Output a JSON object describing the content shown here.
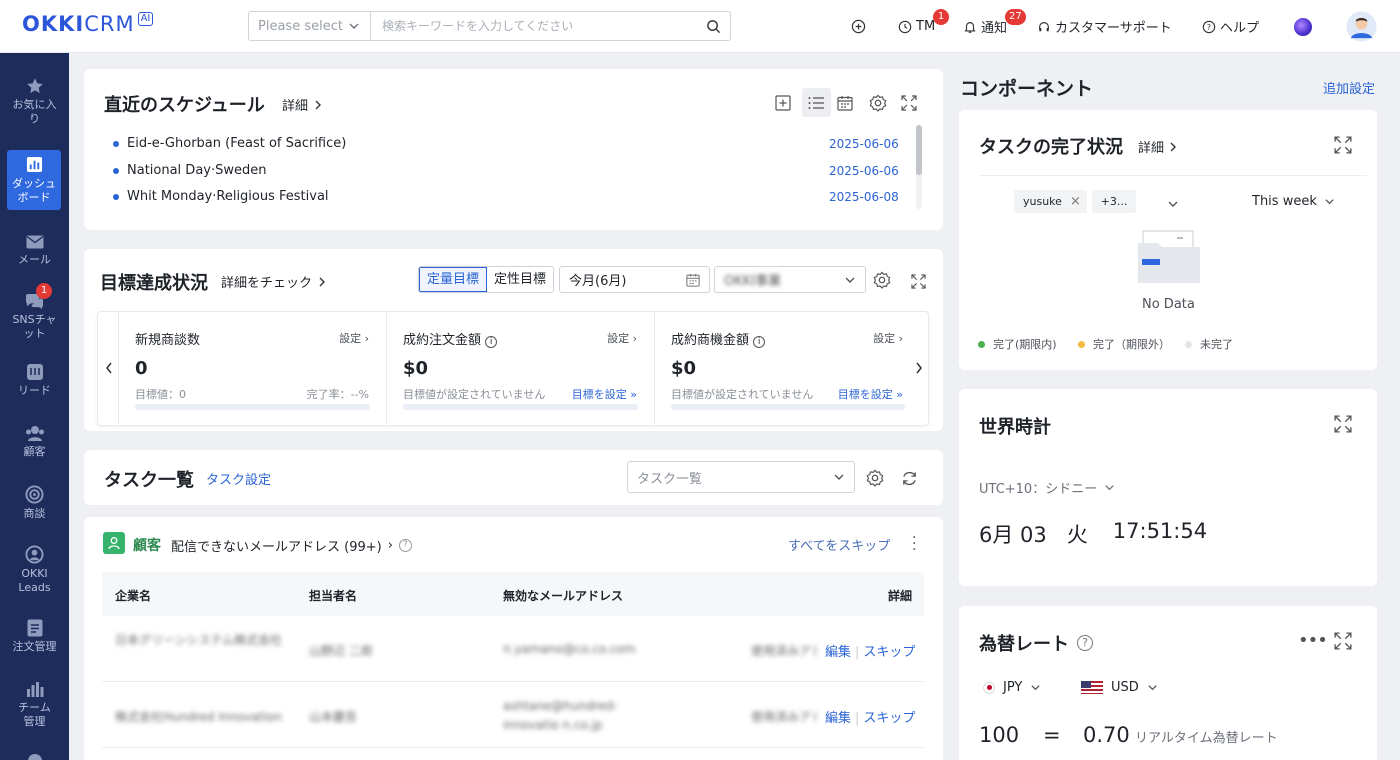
{
  "app": {
    "logo_main": "OKKI",
    "logo_sub": "CRM",
    "logo_ai": "AI"
  },
  "search": {
    "select_placeholder": "Please select",
    "placeholder": "検索キーワードを入力してください"
  },
  "topnav": {
    "tm_label": "TM",
    "tm_badge": "1",
    "notify_label": "通知",
    "notify_badge": "27",
    "support_label": "カスタマーサポート",
    "help_label": "ヘルプ"
  },
  "sidebar": {
    "items": [
      {
        "label": "お気に入り",
        "icon": "star-icon"
      },
      {
        "label": "ダッシュボード",
        "icon": "dashboard-icon"
      },
      {
        "label": "メール",
        "icon": "mail-icon"
      },
      {
        "label": "SNSチャット",
        "icon": "chat-icon",
        "badge": "1"
      },
      {
        "label": "リード",
        "icon": "lead-icon"
      },
      {
        "label": "顧客",
        "icon": "customer-icon"
      },
      {
        "label": "商談",
        "icon": "target-icon"
      },
      {
        "label": "OKKI Leads",
        "icon": "okki-leads-icon"
      },
      {
        "label": "注文管理",
        "icon": "order-icon"
      },
      {
        "label": "チーム管理",
        "icon": "team-icon"
      }
    ]
  },
  "schedule": {
    "title": "直近のスケジュール",
    "detail": "詳細",
    "items": [
      {
        "name": "Eid-e-Ghorban (Feast of Sacrifice)",
        "date": "2025-06-06"
      },
      {
        "name": "National Day·Sweden",
        "date": "2025-06-06"
      },
      {
        "name": "Whit Monday·Religious Festival",
        "date": "2025-06-08"
      }
    ]
  },
  "goals": {
    "title": "目標達成状況",
    "check": "詳細をチェック",
    "tab_quant": "定量目標",
    "tab_qual": "定性目標",
    "month": "今月(6月)",
    "department": "OKKI事業",
    "cards": [
      {
        "title": "新規商談数",
        "set": "設定",
        "value": "0",
        "sub": "目標値：0",
        "right": "完了率：--%"
      },
      {
        "title": "成約注文金額",
        "set": "設定",
        "value": "$0",
        "sub": "目標値が設定されていません",
        "right": "目標を設定"
      },
      {
        "title": "成約商機金額",
        "set": "設定",
        "value": "$0",
        "sub": "目標値が設定されていません",
        "right": "目標を設定"
      }
    ]
  },
  "tasks": {
    "title": "タスク一覧",
    "settings": "タスク設定",
    "select": "タスク一覧"
  },
  "email_tasks": {
    "category": "顧客",
    "title": "配信できないメールアドレス (99+)",
    "skip_all": "すべてをスキップ",
    "headers": [
      "企業名",
      "担当者名",
      "無効なメールアドレス",
      "詳細"
    ],
    "rows": [
      {
        "company": "日本グリーンシステム株式会社",
        "contact": "山野辺 二郎",
        "email": "n.yamano@co.co.com",
        "detail": "使用済みアドレス",
        "edit": "編集",
        "skip": "スキップ"
      },
      {
        "company": "株式会社Hundred Innovation",
        "contact": "山本慶吾",
        "email": "ashtane@hundred-innovatio n.co.jp",
        "detail": "使用済みアドレス",
        "edit": "編集",
        "skip": "スキップ"
      }
    ]
  },
  "components": {
    "title": "コンポーネント",
    "add": "追加設定"
  },
  "task_status": {
    "title": "タスクの完了状況",
    "detail": "詳細",
    "tag": "yusuke",
    "more": "+3...",
    "period": "This week",
    "no_data": "No Data",
    "legend": [
      {
        "label": "完了(期限内)",
        "color": "#4caf50"
      },
      {
        "label": "完了（期限外）",
        "color": "#f5b841"
      },
      {
        "label": "未完了",
        "color": "#e3e5e8"
      }
    ]
  },
  "world_clock": {
    "title": "世界時計",
    "zone": "UTC+10：シドニー",
    "date": "6月 03",
    "weekday": "火",
    "time": "17:51:54"
  },
  "exchange": {
    "title": "為替レート",
    "from": "JPY",
    "to": "USD",
    "amount": "100",
    "equals": "=",
    "result": "0.70",
    "note": "リアルタイム為替レート"
  }
}
